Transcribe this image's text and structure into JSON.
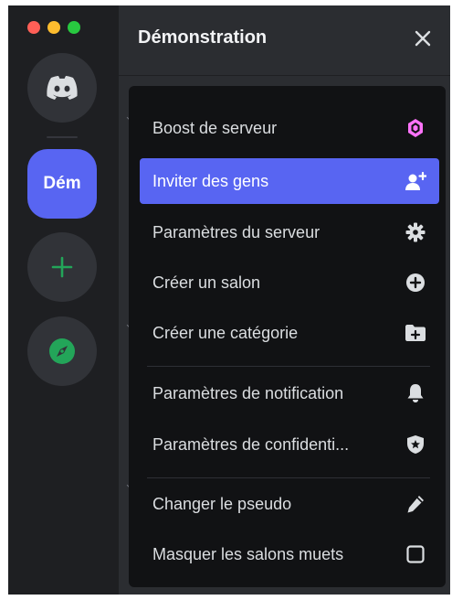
{
  "window": {
    "traffic_lights": {
      "close": "#ff5f57",
      "minimize": "#febc2e",
      "zoom": "#28c840"
    }
  },
  "server_rail": {
    "home_icon": "discord-logo-icon",
    "active_server_label": "Dém",
    "add_icon": "plus-icon",
    "explore_icon": "compass-icon",
    "accent": "#5865f2",
    "green": "#23a559"
  },
  "header": {
    "title": "Démonstration",
    "close_icon": "close-icon"
  },
  "menu": {
    "items": [
      {
        "label": "Boost de serveur",
        "icon": "boost-gem-icon",
        "icon_color": "#ff73fa"
      },
      {
        "label": "Inviter des gens",
        "icon": "add-person-icon",
        "selected": true
      },
      {
        "label": "Paramètres du serveur",
        "icon": "gear-icon"
      },
      {
        "label": "Créer un salon",
        "icon": "plus-circle-icon"
      },
      {
        "label": "Créer une catégorie",
        "icon": "folder-plus-icon"
      },
      {
        "label": "Paramètres de notification",
        "icon": "bell-icon"
      },
      {
        "label": "Paramètres de confidenti...",
        "icon": "shield-icon"
      },
      {
        "label": "Changer le pseudo",
        "icon": "pencil-icon"
      },
      {
        "label": "Masquer les salons muets",
        "icon": "checkbox-icon",
        "checked": false
      }
    ],
    "selected_color": "#5865f2"
  }
}
